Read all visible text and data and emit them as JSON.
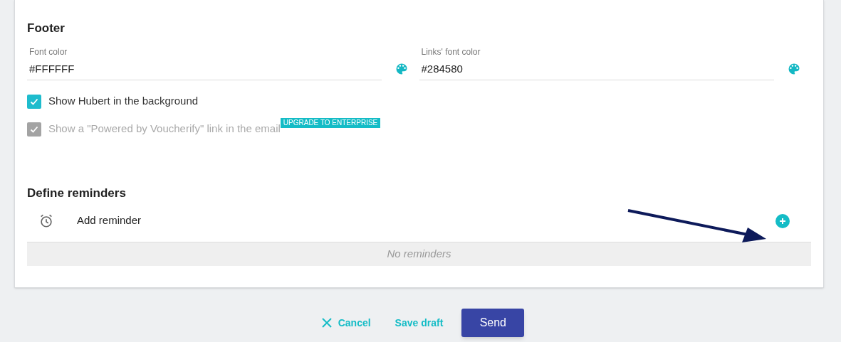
{
  "footer": {
    "title": "Footer",
    "fields": [
      {
        "label": "Font color",
        "value": "#FFFFFF"
      },
      {
        "label": "Links' font color",
        "value": "#284580"
      }
    ],
    "options": [
      {
        "label": "Show Hubert in the background",
        "checked": true,
        "disabled": false
      },
      {
        "label": "Show a \"Powered by Voucherify\" link in the email",
        "checked": true,
        "disabled": true,
        "badge": "UPGRADE TO ENTERPRISE"
      }
    ]
  },
  "reminders": {
    "title": "Define reminders",
    "add_label": "Add reminder",
    "empty_text": "No reminders"
  },
  "actions": {
    "cancel": "Cancel",
    "save_draft": "Save draft",
    "send": "Send"
  }
}
